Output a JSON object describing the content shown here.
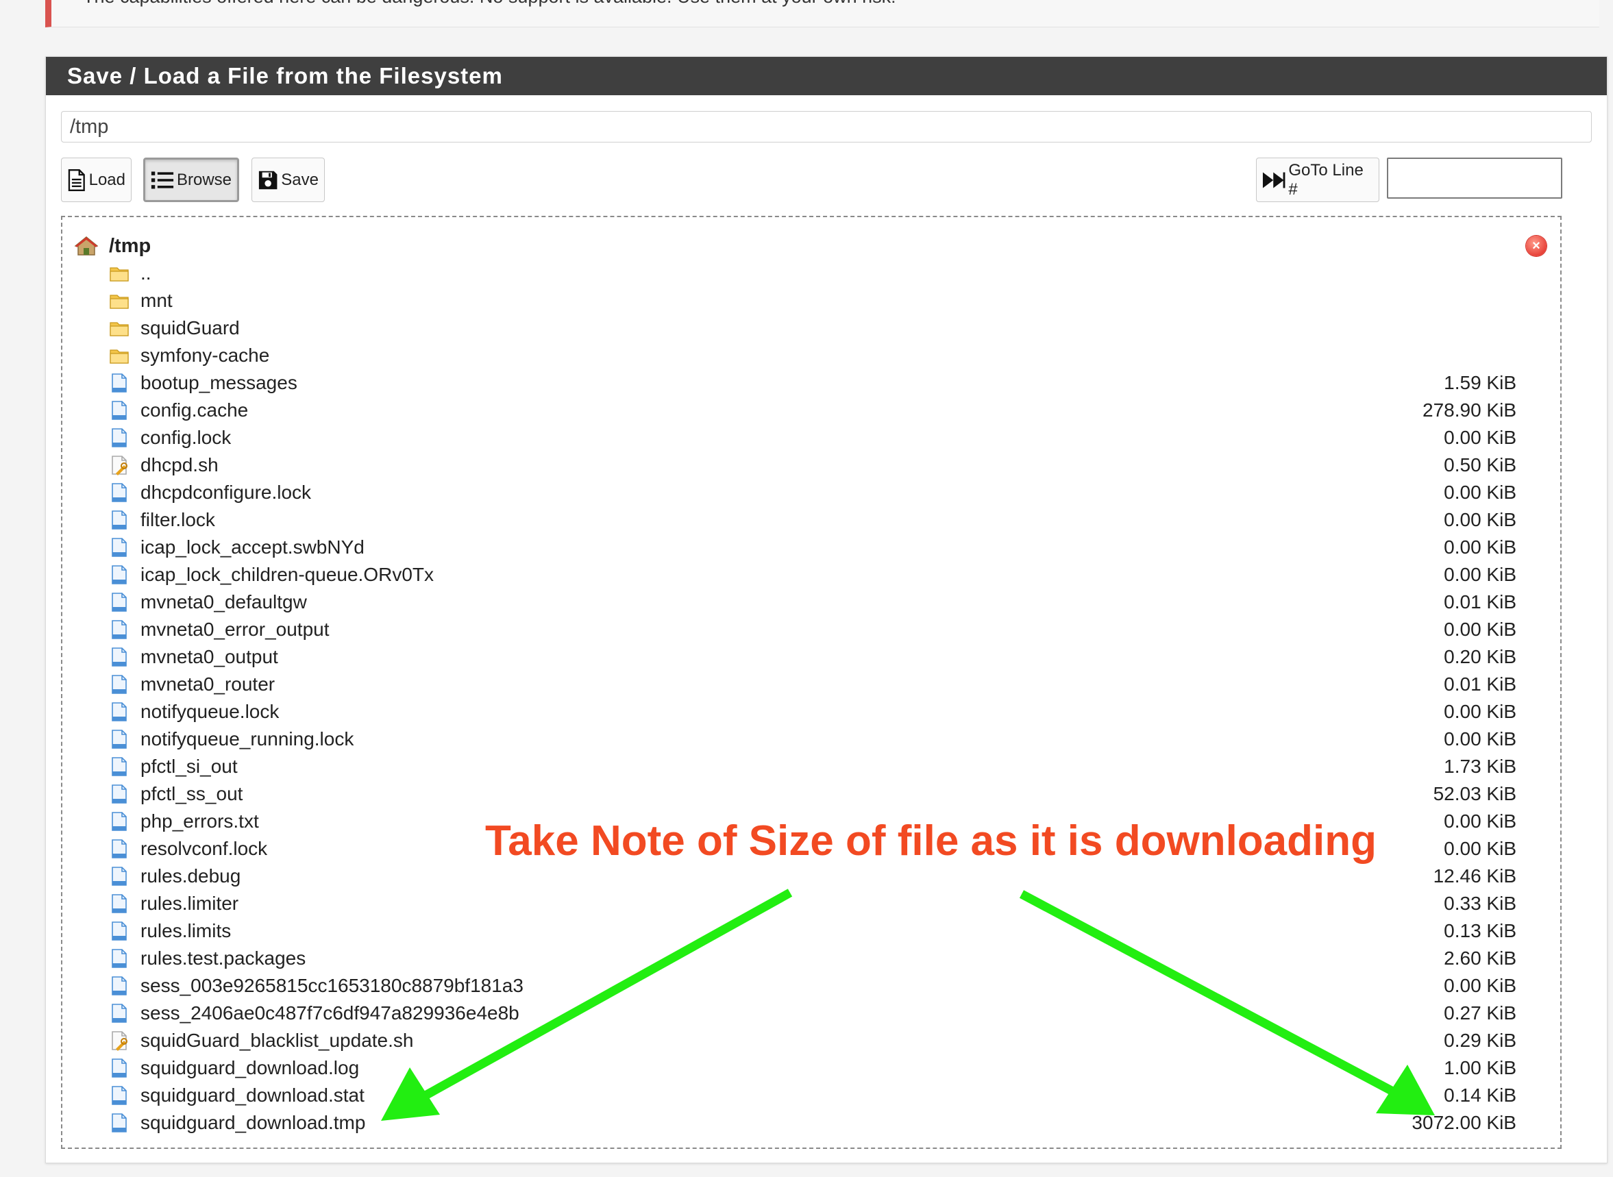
{
  "warning": {
    "text": "The capabilities offered here can be dangerous. No support is available. Use them at your own risk!"
  },
  "panel": {
    "title": "Save / Load a File from the Filesystem"
  },
  "path_input": {
    "value": "/tmp"
  },
  "toolbar": {
    "load_label": "Load",
    "browse_label": "Browse",
    "save_label": "Save",
    "goto_label": "GoTo Line #",
    "goto_value": ""
  },
  "browser": {
    "root": "/tmp",
    "entries": [
      {
        "name": "..",
        "size": "",
        "type": "folder"
      },
      {
        "name": "mnt",
        "size": "",
        "type": "folder"
      },
      {
        "name": "squidGuard",
        "size": "",
        "type": "folder"
      },
      {
        "name": "symfony-cache",
        "size": "",
        "type": "folder"
      },
      {
        "name": "bootup_messages",
        "size": "1.59 KiB",
        "type": "file"
      },
      {
        "name": "config.cache",
        "size": "278.90 KiB",
        "type": "file"
      },
      {
        "name": "config.lock",
        "size": "0.00 KiB",
        "type": "file"
      },
      {
        "name": "dhcpd.sh",
        "size": "0.50 KiB",
        "type": "script"
      },
      {
        "name": "dhcpdconfigure.lock",
        "size": "0.00 KiB",
        "type": "file"
      },
      {
        "name": "filter.lock",
        "size": "0.00 KiB",
        "type": "file"
      },
      {
        "name": "icap_lock_accept.swbNYd",
        "size": "0.00 KiB",
        "type": "file"
      },
      {
        "name": "icap_lock_children-queue.ORv0Tx",
        "size": "0.00 KiB",
        "type": "file"
      },
      {
        "name": "mvneta0_defaultgw",
        "size": "0.01 KiB",
        "type": "file"
      },
      {
        "name": "mvneta0_error_output",
        "size": "0.00 KiB",
        "type": "file"
      },
      {
        "name": "mvneta0_output",
        "size": "0.20 KiB",
        "type": "file"
      },
      {
        "name": "mvneta0_router",
        "size": "0.01 KiB",
        "type": "file"
      },
      {
        "name": "notifyqueue.lock",
        "size": "0.00 KiB",
        "type": "file"
      },
      {
        "name": "notifyqueue_running.lock",
        "size": "0.00 KiB",
        "type": "file"
      },
      {
        "name": "pfctl_si_out",
        "size": "1.73 KiB",
        "type": "file"
      },
      {
        "name": "pfctl_ss_out",
        "size": "52.03 KiB",
        "type": "file"
      },
      {
        "name": "php_errors.txt",
        "size": "0.00 KiB",
        "type": "file"
      },
      {
        "name": "resolvconf.lock",
        "size": "0.00 KiB",
        "type": "file"
      },
      {
        "name": "rules.debug",
        "size": "12.46 KiB",
        "type": "file"
      },
      {
        "name": "rules.limiter",
        "size": "0.33 KiB",
        "type": "file"
      },
      {
        "name": "rules.limits",
        "size": "0.13 KiB",
        "type": "file"
      },
      {
        "name": "rules.test.packages",
        "size": "2.60 KiB",
        "type": "file"
      },
      {
        "name": "sess_003e9265815cc1653180c8879bf181a3",
        "size": "0.00 KiB",
        "type": "file"
      },
      {
        "name": "sess_2406ae0c487f7c6df947a829936e4e8b",
        "size": "0.27 KiB",
        "type": "file"
      },
      {
        "name": "squidGuard_blacklist_update.sh",
        "size": "0.29 KiB",
        "type": "script"
      },
      {
        "name": "squidguard_download.log",
        "size": "1.00 KiB",
        "type": "file"
      },
      {
        "name": "squidguard_download.stat",
        "size": "0.14 KiB",
        "type": "file"
      },
      {
        "name": "squidguard_download.tmp",
        "size": "3072.00 KiB",
        "type": "file"
      }
    ]
  },
  "annotation": {
    "text": "Take Note of Size of file as it is downloading",
    "text_color": "#f24a22",
    "arrow_color": "#22ee11"
  }
}
